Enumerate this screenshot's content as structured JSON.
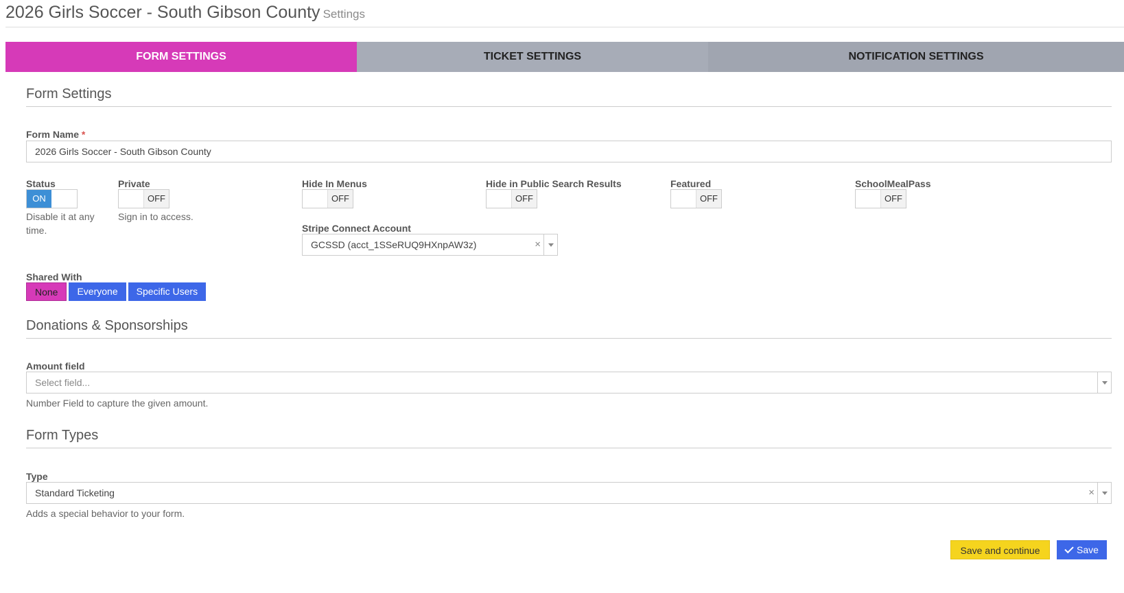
{
  "header": {
    "title": "2026 Girls Soccer - South Gibson County",
    "subtitle": "Settings"
  },
  "tabs": [
    {
      "label": "FORM SETTINGS",
      "active": true
    },
    {
      "label": "TICKET SETTINGS",
      "active": false
    },
    {
      "label": "NOTIFICATION SETTINGS",
      "active": false
    }
  ],
  "form_settings": {
    "section_title": "Form Settings",
    "form_name_label": "Form Name",
    "required_mark": "*",
    "form_name_value": "2026 Girls Soccer - South Gibson County",
    "status": {
      "label": "Status",
      "state": "ON",
      "help": "Disable it at any time."
    },
    "private": {
      "label": "Private",
      "state": "OFF",
      "help": "Sign in to access."
    },
    "hide_in_menus": {
      "label": "Hide In Menus",
      "state": "OFF"
    },
    "hide_in_search": {
      "label": "Hide in Public Search Results",
      "state": "OFF"
    },
    "featured": {
      "label": "Featured",
      "state": "OFF"
    },
    "school_meal_pass": {
      "label": "SchoolMealPass",
      "state": "OFF"
    },
    "stripe": {
      "label": "Stripe Connect Account",
      "value": "GCSSD (acct_1SSeRUQ9HXnpAW3z)",
      "clear": "×"
    },
    "shared_with": {
      "label": "Shared With",
      "options": [
        "None",
        "Everyone",
        "Specific Users"
      ],
      "selected": "None"
    }
  },
  "donations": {
    "section_title": "Donations & Sponsorships",
    "amount_label": "Amount field",
    "amount_placeholder": "Select field...",
    "amount_help": "Number Field to capture the given amount."
  },
  "form_types": {
    "section_title": "Form Types",
    "type_label": "Type",
    "type_value": "Standard Ticketing",
    "clear": "×",
    "type_help": "Adds a special behavior to your form."
  },
  "actions": {
    "save_continue": "Save and continue",
    "save": "Save"
  },
  "colors": {
    "accent": "#d63ab8",
    "primary": "#3d67e8",
    "toggle_on": "#3d8fd6",
    "save_continue": "#f5d41e"
  }
}
